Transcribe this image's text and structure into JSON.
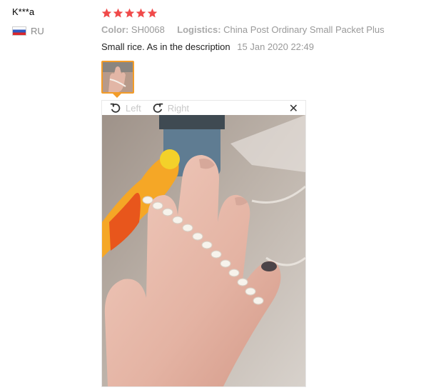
{
  "reviewer": {
    "name": "K***a",
    "country_code": "RU",
    "flag_icon": "russia-flag-icon"
  },
  "rating": {
    "stars": 5,
    "max": 5,
    "color": "#f04a4a"
  },
  "meta": {
    "color_label": "Color:",
    "color_value": "SH0068",
    "logistics_label": "Logistics:",
    "logistics_value": "China Post Ordinary Small Packet Plus"
  },
  "review": {
    "text": "Small rice. As in the description",
    "date": "15 Jan 2020 22:49"
  },
  "viewer": {
    "rotate_left_label": "Left",
    "rotate_right_label": "Right",
    "close_symbol": "✕"
  },
  "accent_color": "#f39c28"
}
